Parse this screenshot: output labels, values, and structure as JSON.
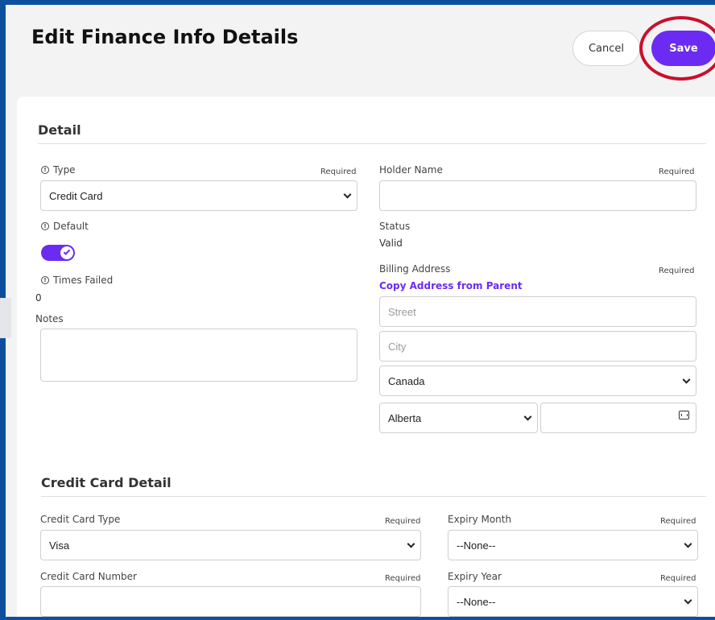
{
  "header": {
    "title": "Edit Finance Info Details",
    "cancel_label": "Cancel",
    "save_label": "Save"
  },
  "detail": {
    "section_title": "Detail",
    "type": {
      "label": "Type",
      "required": "Required",
      "value": "Credit Card"
    },
    "holder_name": {
      "label": "Holder Name",
      "required": "Required",
      "value": ""
    },
    "default": {
      "label": "Default",
      "checked": true
    },
    "status": {
      "label": "Status",
      "value": "Valid"
    },
    "times_failed": {
      "label": "Times Failed",
      "value": "0"
    },
    "billing_address": {
      "label": "Billing Address",
      "required": "Required",
      "copy_link": "Copy Address from Parent",
      "street_placeholder": "Street",
      "city_placeholder": "City",
      "country": "Canada",
      "province": "Alberta",
      "postal_value": ""
    },
    "notes": {
      "label": "Notes",
      "value": ""
    }
  },
  "credit_card_detail": {
    "section_title": "Credit Card Detail",
    "card_type": {
      "label": "Credit Card Type",
      "required": "Required",
      "value": "Visa"
    },
    "expiry_month": {
      "label": "Expiry Month",
      "required": "Required",
      "value": "--None--"
    },
    "card_number": {
      "label": "Credit Card Number",
      "required": "Required",
      "value": ""
    },
    "expiry_year": {
      "label": "Expiry Year",
      "required": "Required",
      "value": "--None--"
    }
  },
  "colors": {
    "accent": "#6c2bf2",
    "highlight_ring": "#c8102e",
    "frame": "#0d4f9e"
  }
}
